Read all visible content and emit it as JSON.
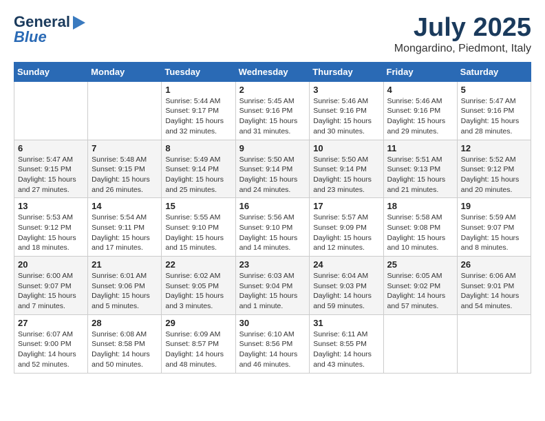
{
  "header": {
    "logo_line1": "General",
    "logo_line2": "Blue",
    "month": "July 2025",
    "location": "Mongardino, Piedmont, Italy"
  },
  "weekdays": [
    "Sunday",
    "Monday",
    "Tuesday",
    "Wednesday",
    "Thursday",
    "Friday",
    "Saturday"
  ],
  "weeks": [
    [
      {
        "day": "",
        "info": ""
      },
      {
        "day": "",
        "info": ""
      },
      {
        "day": "1",
        "info": "Sunrise: 5:44 AM\nSunset: 9:17 PM\nDaylight: 15 hours and 32 minutes."
      },
      {
        "day": "2",
        "info": "Sunrise: 5:45 AM\nSunset: 9:16 PM\nDaylight: 15 hours and 31 minutes."
      },
      {
        "day": "3",
        "info": "Sunrise: 5:46 AM\nSunset: 9:16 PM\nDaylight: 15 hours and 30 minutes."
      },
      {
        "day": "4",
        "info": "Sunrise: 5:46 AM\nSunset: 9:16 PM\nDaylight: 15 hours and 29 minutes."
      },
      {
        "day": "5",
        "info": "Sunrise: 5:47 AM\nSunset: 9:16 PM\nDaylight: 15 hours and 28 minutes."
      }
    ],
    [
      {
        "day": "6",
        "info": "Sunrise: 5:47 AM\nSunset: 9:15 PM\nDaylight: 15 hours and 27 minutes."
      },
      {
        "day": "7",
        "info": "Sunrise: 5:48 AM\nSunset: 9:15 PM\nDaylight: 15 hours and 26 minutes."
      },
      {
        "day": "8",
        "info": "Sunrise: 5:49 AM\nSunset: 9:14 PM\nDaylight: 15 hours and 25 minutes."
      },
      {
        "day": "9",
        "info": "Sunrise: 5:50 AM\nSunset: 9:14 PM\nDaylight: 15 hours and 24 minutes."
      },
      {
        "day": "10",
        "info": "Sunrise: 5:50 AM\nSunset: 9:14 PM\nDaylight: 15 hours and 23 minutes."
      },
      {
        "day": "11",
        "info": "Sunrise: 5:51 AM\nSunset: 9:13 PM\nDaylight: 15 hours and 21 minutes."
      },
      {
        "day": "12",
        "info": "Sunrise: 5:52 AM\nSunset: 9:12 PM\nDaylight: 15 hours and 20 minutes."
      }
    ],
    [
      {
        "day": "13",
        "info": "Sunrise: 5:53 AM\nSunset: 9:12 PM\nDaylight: 15 hours and 18 minutes."
      },
      {
        "day": "14",
        "info": "Sunrise: 5:54 AM\nSunset: 9:11 PM\nDaylight: 15 hours and 17 minutes."
      },
      {
        "day": "15",
        "info": "Sunrise: 5:55 AM\nSunset: 9:10 PM\nDaylight: 15 hours and 15 minutes."
      },
      {
        "day": "16",
        "info": "Sunrise: 5:56 AM\nSunset: 9:10 PM\nDaylight: 15 hours and 14 minutes."
      },
      {
        "day": "17",
        "info": "Sunrise: 5:57 AM\nSunset: 9:09 PM\nDaylight: 15 hours and 12 minutes."
      },
      {
        "day": "18",
        "info": "Sunrise: 5:58 AM\nSunset: 9:08 PM\nDaylight: 15 hours and 10 minutes."
      },
      {
        "day": "19",
        "info": "Sunrise: 5:59 AM\nSunset: 9:07 PM\nDaylight: 15 hours and 8 minutes."
      }
    ],
    [
      {
        "day": "20",
        "info": "Sunrise: 6:00 AM\nSunset: 9:07 PM\nDaylight: 15 hours and 7 minutes."
      },
      {
        "day": "21",
        "info": "Sunrise: 6:01 AM\nSunset: 9:06 PM\nDaylight: 15 hours and 5 minutes."
      },
      {
        "day": "22",
        "info": "Sunrise: 6:02 AM\nSunset: 9:05 PM\nDaylight: 15 hours and 3 minutes."
      },
      {
        "day": "23",
        "info": "Sunrise: 6:03 AM\nSunset: 9:04 PM\nDaylight: 15 hours and 1 minute."
      },
      {
        "day": "24",
        "info": "Sunrise: 6:04 AM\nSunset: 9:03 PM\nDaylight: 14 hours and 59 minutes."
      },
      {
        "day": "25",
        "info": "Sunrise: 6:05 AM\nSunset: 9:02 PM\nDaylight: 14 hours and 57 minutes."
      },
      {
        "day": "26",
        "info": "Sunrise: 6:06 AM\nSunset: 9:01 PM\nDaylight: 14 hours and 54 minutes."
      }
    ],
    [
      {
        "day": "27",
        "info": "Sunrise: 6:07 AM\nSunset: 9:00 PM\nDaylight: 14 hours and 52 minutes."
      },
      {
        "day": "28",
        "info": "Sunrise: 6:08 AM\nSunset: 8:58 PM\nDaylight: 14 hours and 50 minutes."
      },
      {
        "day": "29",
        "info": "Sunrise: 6:09 AM\nSunset: 8:57 PM\nDaylight: 14 hours and 48 minutes."
      },
      {
        "day": "30",
        "info": "Sunrise: 6:10 AM\nSunset: 8:56 PM\nDaylight: 14 hours and 46 minutes."
      },
      {
        "day": "31",
        "info": "Sunrise: 6:11 AM\nSunset: 8:55 PM\nDaylight: 14 hours and 43 minutes."
      },
      {
        "day": "",
        "info": ""
      },
      {
        "day": "",
        "info": ""
      }
    ]
  ]
}
